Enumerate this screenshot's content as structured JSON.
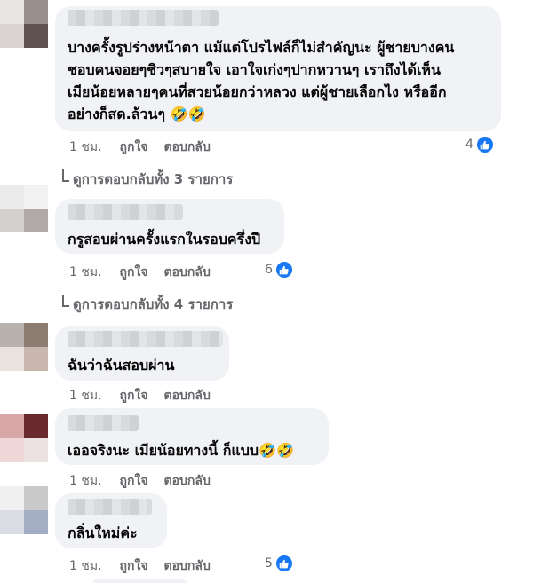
{
  "comments": [
    {
      "author_blurred": true,
      "lines": [
        "บางครั้งรูปร่างหน้าตา แม้แต่โปรไฟล์ก็ไม่สำคัญนะ ผู้ชายบางคน",
        "ชอบคนจอยๆชิวๆสบายใจ เอาใจเก่งๆปากหวานๆ เราถึงได้เห็น",
        "เมียน้อยหลายๆคนที่สวยน้อยกว่าหลวง แต่ผู้ชายเลือกไง หรืออีก",
        "อย่างก็สด.ล้วนๆ 🤣🤣"
      ],
      "time": "1 ชม.",
      "like_label": "ถูกใจ",
      "reply_label": "ตอบกลับ",
      "reaction_count": "4"
    },
    {
      "author_blurred": true,
      "lines": [
        "กรูสอบผ่านครั้งแรกในรอบครึ่งปี"
      ],
      "time": "1 ชม.",
      "like_label": "ถูกใจ",
      "reply_label": "ตอบกลับ",
      "reaction_count": "6"
    },
    {
      "author_blurred": true,
      "lines": [
        "ฉันว่าฉันสอบผ่าน"
      ],
      "time": "1 ชม.",
      "like_label": "ถูกใจ",
      "reply_label": "ตอบกลับ",
      "reaction_count": ""
    },
    {
      "author_blurred": true,
      "lines": [
        "เออจริงนะ เมียน้อยทางนี้ ก็แบบ🤣🤣"
      ],
      "time": "1 ชม.",
      "like_label": "ถูกใจ",
      "reply_label": "ตอบกลับ",
      "reaction_count": ""
    },
    {
      "author_blurred": true,
      "lines": [
        "กลิ่นใหม่ค่ะ"
      ],
      "time": "1 ชม.",
      "like_label": "ถูกใจ",
      "reply_label": "ตอบกลับ",
      "reaction_count": "5"
    }
  ],
  "view_replies": [
    "ดูการตอบกลับทั้ง 3 รายการ",
    "ดูการตอบกลับทั้ง 4 รายการ"
  ],
  "colors": {
    "bubble": "#f0f2f5",
    "meta_text": "#65676b",
    "like_blue": "#1877f2"
  },
  "icons": {
    "reaction": "thumbs-up-icon",
    "view_more": "reply-arrow-icon"
  }
}
